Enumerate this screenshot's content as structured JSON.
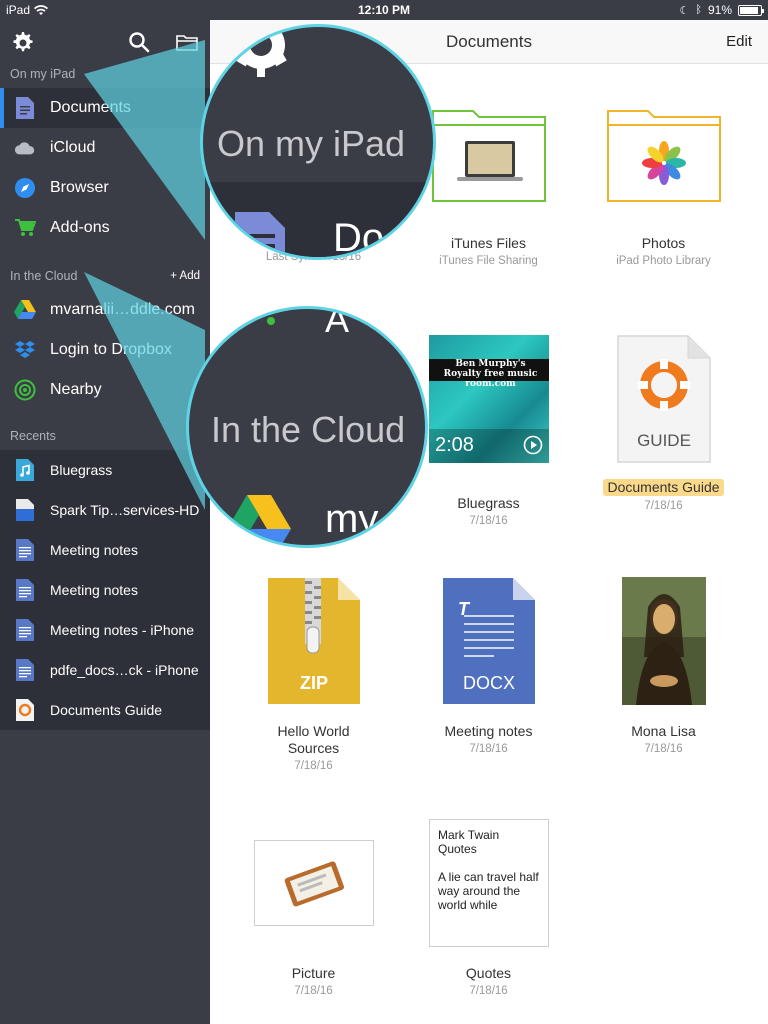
{
  "status_bar": {
    "device": "iPad",
    "time": "12:10 PM",
    "battery": "91%",
    "battery_level": 0.91
  },
  "sidebar": {
    "section_on_ipad": "On my iPad",
    "on_ipad_items": [
      {
        "label": "Documents",
        "icon": "document-icon",
        "active": true
      },
      {
        "label": "iCloud",
        "icon": "cloud-icon"
      },
      {
        "label": "Browser",
        "icon": "compass-icon"
      },
      {
        "label": "Add-ons",
        "icon": "cart-icon"
      }
    ],
    "section_cloud": "In the Cloud",
    "add_label": "+ Add",
    "cloud_items": [
      {
        "label": "mvarnalii…ddle.com",
        "icon": "google-drive-icon"
      },
      {
        "label": "Login to Dropbox",
        "icon": "dropbox-icon"
      },
      {
        "label": "Nearby",
        "icon": "nearby-icon"
      }
    ],
    "section_recents": "Recents",
    "recent_items": [
      {
        "label": "Bluegrass",
        "icon": "audio-file-icon"
      },
      {
        "label": "Spark Tip…services-HD",
        "icon": "file-icon"
      },
      {
        "label": "Meeting notes",
        "icon": "docx-file-icon"
      },
      {
        "label": "Meeting notes",
        "icon": "docx-file-icon"
      },
      {
        "label": "Meeting notes - iPhone",
        "icon": "docx-file-icon"
      },
      {
        "label": "pdfe_docs…ck - iPhone",
        "icon": "docx-file-icon"
      },
      {
        "label": "Documents Guide",
        "icon": "guide-file-icon"
      }
    ]
  },
  "main": {
    "title": "Documents",
    "edit_label": "Edit",
    "items": [
      {
        "name": "",
        "sub": "Last Sync: 7/18/16"
      },
      {
        "name": "iTunes Files",
        "sub": "iTunes File Sharing"
      },
      {
        "name": "Photos",
        "sub": "iPad Photo Library"
      },
      {
        "name": "Bluegrass",
        "sub": "7/18/16",
        "duration": "2:08",
        "thumb_text_1": "Ben Murphy's",
        "thumb_text_2": "Royalty free music room.com"
      },
      {
        "name": "Documents Guide",
        "sub": "7/18/16",
        "badge": "GUIDE"
      },
      {
        "name": "Hello World\nSources",
        "sub": "7/18/16",
        "badge": "ZIP"
      },
      {
        "name": "Meeting notes",
        "sub": "7/18/16",
        "badge": "DOCX",
        "badge_t": "T"
      },
      {
        "name": "Mona Lisa",
        "sub": "7/18/16"
      },
      {
        "name": "Picture",
        "sub": "7/18/16"
      },
      {
        "name": "Quotes",
        "sub": "7/18/16",
        "preview_title": "Mark Twain Quotes",
        "preview_body": "A lie can travel half way around the world while"
      }
    ]
  },
  "callouts": {
    "top": "On my iPad",
    "bottom": "In the Cloud",
    "top_partial": "Do",
    "bottom_partial": "my",
    "bottom_partial_2": "A"
  },
  "colors": {
    "sidebar_bg": "#3a3d45",
    "accent_blue": "#2f8ef0",
    "callout_cyan": "#5fd3e6",
    "highlight": "#fbd98a"
  }
}
